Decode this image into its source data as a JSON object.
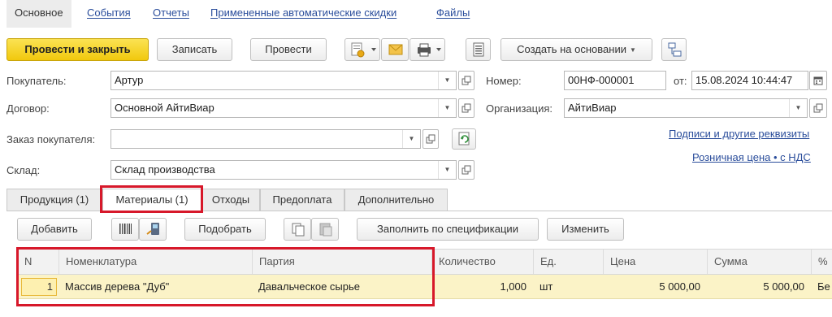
{
  "top_tabs": {
    "active": "Основное",
    "links": [
      "События",
      "Отчеты",
      "Примененные автоматические скидки",
      "Файлы"
    ]
  },
  "toolbar": {
    "post_close": "Провести и закрыть",
    "save": "Записать",
    "post": "Провести",
    "create_based": "Создать на основании"
  },
  "form": {
    "buyer_label": "Покупатель:",
    "buyer_value": "Артур",
    "contract_label": "Договор:",
    "contract_value": "Основной АйтиВиар",
    "order_label": "Заказ покупателя:",
    "order_value": "",
    "warehouse_label": "Склад:",
    "warehouse_value": "Склад производства",
    "number_label": "Номер:",
    "number_value": "00НФ-000001",
    "date_label": "от:",
    "date_value": "15.08.2024 10:44:47",
    "org_label": "Организация:",
    "org_value": "АйтиВиар",
    "link_signatures": "Подписи и другие реквизиты",
    "link_price": "Розничная цена • с НДС"
  },
  "content_tabs": [
    "Продукция (1)",
    "Материалы (1)",
    "Отходы",
    "Предоплата",
    "Дополнительно"
  ],
  "active_content_tab": "Материалы (1)",
  "table_toolbar": {
    "add": "Добавить",
    "pick": "Подобрать",
    "fill_spec": "Заполнить по спецификации",
    "change": "Изменить"
  },
  "table": {
    "columns": [
      "N",
      "Номенклатура",
      "Партия",
      "Количество",
      "Ед.",
      "Цена",
      "Сумма",
      "%"
    ],
    "rows": [
      {
        "n": "1",
        "item": "Массив дерева \"Дуб\"",
        "batch": "Давальческое сырье",
        "qty": "1,000",
        "unit": "шт",
        "price": "5 000,00",
        "sum": "5 000,00",
        "pct": "Бе"
      }
    ]
  },
  "colors": {
    "accent_yellow": "#f5d01c",
    "link_blue": "#2a4d9b",
    "highlight_red": "#d7182a",
    "row_selected": "#fbf3c7"
  }
}
